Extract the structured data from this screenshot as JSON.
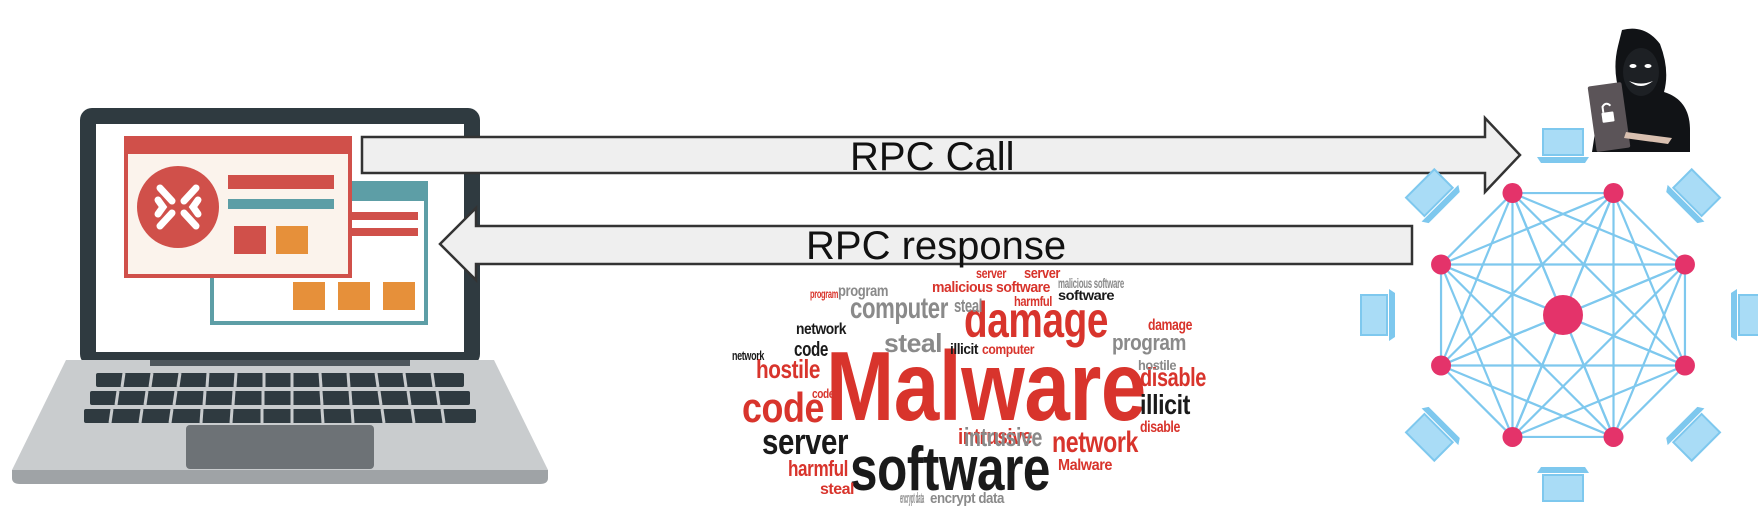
{
  "arrows": {
    "call_label": "RPC Call",
    "response_label": "RPC response"
  },
  "wordcloud": {
    "words": [
      "Malware",
      "software",
      "damage",
      "code",
      "server",
      "computer",
      "hostile",
      "steal",
      "network",
      "illicit",
      "disable",
      "harmful",
      "intrusive",
      "program",
      "malicious software",
      "encrypt data",
      "code",
      "server",
      "network",
      "program",
      "disable",
      "damage",
      "steal",
      "harmful",
      "illicit",
      "Malware",
      "hostile",
      "computer",
      "software",
      "intrusive",
      "encrypt data",
      "network",
      "code",
      "steal",
      "server",
      "program",
      "malicious software"
    ]
  },
  "colors": {
    "arrow_fill": "#efefef",
    "arrow_stroke": "#333333",
    "laptop_frame": "#2f3a40",
    "window_red": "#d0504a",
    "window_teal": "#5d9ea6",
    "window_orange": "#e6903a",
    "network_blue": "#7ec8ee",
    "network_node": "#e4336a",
    "wordcloud_red": "#d8342c",
    "wordcloud_dark": "#1a1a1a",
    "wordcloud_gray": "#8a8a8a"
  },
  "icons": {
    "laptop": "laptop-icon",
    "malware_window": "malware-window-icon",
    "hacker": "hacker-icon",
    "network": "network-mesh-icon"
  }
}
